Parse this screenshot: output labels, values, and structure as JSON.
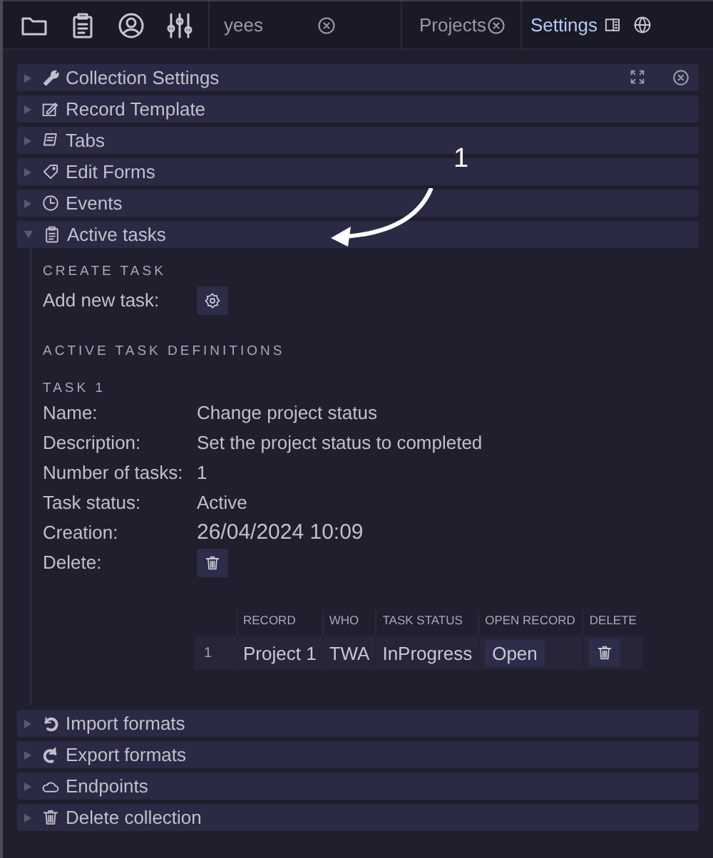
{
  "tabs": [
    {
      "label": "yees",
      "selected": false,
      "closable": true
    },
    {
      "label": "Projects",
      "selected": false,
      "closable": true
    },
    {
      "label": "Settings",
      "selected": true,
      "closable": false
    }
  ],
  "sections": [
    {
      "title": "Collection Settings",
      "expanded": false,
      "controls": true
    },
    {
      "title": "Record Template",
      "expanded": false,
      "controls": false
    },
    {
      "title": "Tabs",
      "expanded": false,
      "controls": false
    },
    {
      "title": "Edit Forms",
      "expanded": false,
      "controls": false
    },
    {
      "title": "Events",
      "expanded": false,
      "controls": false
    },
    {
      "title": "Active tasks",
      "expanded": true,
      "controls": false
    },
    {
      "title": "Import formats",
      "expanded": false,
      "controls": false
    },
    {
      "title": "Export formats",
      "expanded": false,
      "controls": false
    },
    {
      "title": "Endpoints",
      "expanded": false,
      "controls": false
    },
    {
      "title": "Delete collection",
      "expanded": false,
      "controls": false
    }
  ],
  "create_task": {
    "heading": "CREATE TASK",
    "label": "Add new task:"
  },
  "definitions": {
    "heading": "ACTIVE TASK DEFINITIONS",
    "tasks": [
      {
        "heading": "TASK 1",
        "fields": [
          {
            "label": "Name:",
            "value": "Change project status",
            "kind": "text"
          },
          {
            "label": "Description:",
            "value": "Set the project status to completed",
            "kind": "text"
          },
          {
            "label": "Number of tasks:",
            "value": "1",
            "kind": "text"
          },
          {
            "label": "Task status:",
            "value": "Active",
            "kind": "text"
          },
          {
            "label": "Creation:",
            "value": "26/04/2024 10:09",
            "kind": "date"
          },
          {
            "label": "Delete:",
            "kind": "button"
          }
        ],
        "table": {
          "columns": [
            "RECORD",
            "WHO",
            "TASK STATUS",
            "OPEN RECORD",
            "DELETE"
          ],
          "rows": [
            {
              "index": "1",
              "record": "Project 1",
              "who": "TWA",
              "status": "InProgress",
              "open": "Open"
            }
          ]
        }
      }
    ]
  },
  "annotation": {
    "label": "1"
  }
}
